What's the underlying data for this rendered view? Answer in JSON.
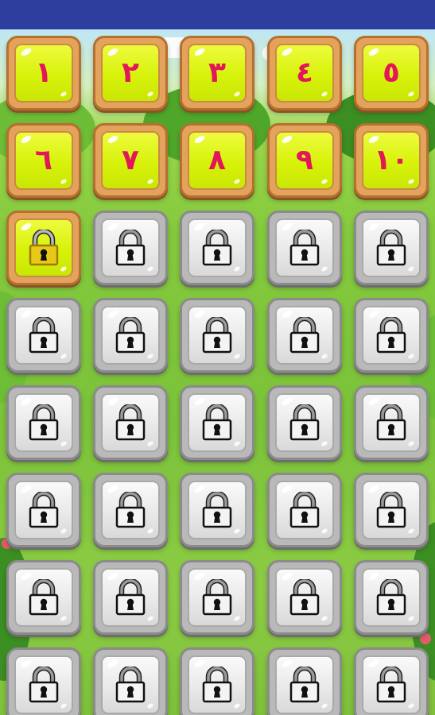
{
  "colors": {
    "status_bar": "#2d3e9e",
    "unlocked_face": "#d7f20a",
    "unlocked_frame": "#e3a35d",
    "locked_face": "#e9e9e9",
    "locked_frame": "#b9b9b9",
    "number_color": "#e2165a"
  },
  "levels": [
    {
      "label": "١",
      "state": "unlocked"
    },
    {
      "label": "٢",
      "state": "unlocked"
    },
    {
      "label": "٣",
      "state": "unlocked"
    },
    {
      "label": "٤",
      "state": "unlocked"
    },
    {
      "label": "٥",
      "state": "unlocked"
    },
    {
      "label": "٦",
      "state": "unlocked"
    },
    {
      "label": "٧",
      "state": "unlocked"
    },
    {
      "label": "٨",
      "state": "unlocked"
    },
    {
      "label": "٩",
      "state": "unlocked"
    },
    {
      "label": "١٠",
      "state": "unlocked"
    },
    {
      "icon": "padlock-gold-icon",
      "state": "next-locked"
    },
    {
      "icon": "padlock-icon",
      "state": "locked"
    },
    {
      "icon": "padlock-icon",
      "state": "locked"
    },
    {
      "icon": "padlock-icon",
      "state": "locked"
    },
    {
      "icon": "padlock-icon",
      "state": "locked"
    },
    {
      "icon": "padlock-icon",
      "state": "locked"
    },
    {
      "icon": "padlock-icon",
      "state": "locked"
    },
    {
      "icon": "padlock-icon",
      "state": "locked"
    },
    {
      "icon": "padlock-icon",
      "state": "locked"
    },
    {
      "icon": "padlock-icon",
      "state": "locked"
    },
    {
      "icon": "padlock-icon",
      "state": "locked"
    },
    {
      "icon": "padlock-icon",
      "state": "locked"
    },
    {
      "icon": "padlock-icon",
      "state": "locked"
    },
    {
      "icon": "padlock-icon",
      "state": "locked"
    },
    {
      "icon": "padlock-icon",
      "state": "locked"
    },
    {
      "icon": "padlock-icon",
      "state": "locked"
    },
    {
      "icon": "padlock-icon",
      "state": "locked"
    },
    {
      "icon": "padlock-icon",
      "state": "locked"
    },
    {
      "icon": "padlock-icon",
      "state": "locked"
    },
    {
      "icon": "padlock-icon",
      "state": "locked"
    },
    {
      "icon": "padlock-icon",
      "state": "locked"
    },
    {
      "icon": "padlock-icon",
      "state": "locked"
    },
    {
      "icon": "padlock-icon",
      "state": "locked"
    },
    {
      "icon": "padlock-icon",
      "state": "locked"
    },
    {
      "icon": "padlock-icon",
      "state": "locked"
    },
    {
      "icon": "padlock-icon",
      "state": "locked"
    },
    {
      "icon": "padlock-icon",
      "state": "locked"
    },
    {
      "icon": "padlock-icon",
      "state": "locked"
    },
    {
      "icon": "padlock-icon",
      "state": "locked"
    },
    {
      "icon": "padlock-icon",
      "state": "locked"
    }
  ]
}
